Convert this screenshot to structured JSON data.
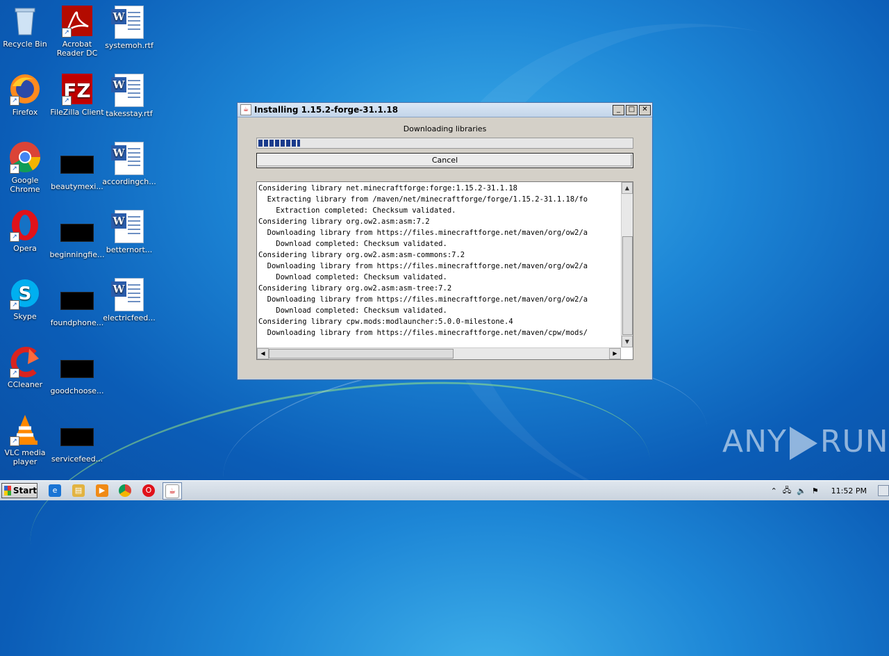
{
  "desktop": {
    "icons": [
      {
        "label": "Recycle Bin",
        "icon": "recycle-bin-icon"
      },
      {
        "label": "Acrobat Reader DC",
        "icon": "acrobat-icon"
      },
      {
        "label": "systemoh.rtf",
        "icon": "word-doc-icon"
      },
      {
        "label": "Firefox",
        "icon": "firefox-icon"
      },
      {
        "label": "FileZilla Client",
        "icon": "filezilla-icon"
      },
      {
        "label": "takesstay.rtf",
        "icon": "word-doc-icon"
      },
      {
        "label": "Google Chrome",
        "icon": "chrome-icon"
      },
      {
        "label": "beautymexi...",
        "icon": "black-thumb-icon"
      },
      {
        "label": "accordingch...",
        "icon": "word-doc-icon"
      },
      {
        "label": "Opera",
        "icon": "opera-icon"
      },
      {
        "label": "beginningfie...",
        "icon": "black-thumb-icon"
      },
      {
        "label": "betternort...",
        "icon": "word-doc-icon"
      },
      {
        "label": "Skype",
        "icon": "skype-icon"
      },
      {
        "label": "foundphone...",
        "icon": "black-thumb-icon"
      },
      {
        "label": "electricfeed...",
        "icon": "word-doc-icon"
      },
      {
        "label": "CCleaner",
        "icon": "ccleaner-icon"
      },
      {
        "label": "goodchoose...",
        "icon": "black-thumb-icon"
      },
      {
        "label": "VLC media player",
        "icon": "vlc-icon"
      },
      {
        "label": "servicefeed...",
        "icon": "black-thumb-icon"
      }
    ]
  },
  "dialog": {
    "title": "Installing 1.15.2-forge-31.1.18",
    "status": "Downloading libraries",
    "cancel_label": "Cancel",
    "progress": 0.11,
    "log_lines": [
      "Considering library net.minecraftforge:forge:1.15.2-31.1.18",
      "  Extracting library from /maven/net/minecraftforge/forge/1.15.2-31.1.18/fo",
      "    Extraction completed: Checksum validated.",
      "Considering library org.ow2.asm:asm:7.2",
      "  Downloading library from https://files.minecraftforge.net/maven/org/ow2/a",
      "    Download completed: Checksum validated.",
      "Considering library org.ow2.asm:asm-commons:7.2",
      "  Downloading library from https://files.minecraftforge.net/maven/org/ow2/a",
      "    Download completed: Checksum validated.",
      "Considering library org.ow2.asm:asm-tree:7.2",
      "  Downloading library from https://files.minecraftforge.net/maven/org/ow2/a",
      "    Download completed: Checksum validated.",
      "Considering library cpw.mods:modlauncher:5.0.0-milestone.4",
      "  Downloading library from https://files.minecraftforge.net/maven/cpw/mods/"
    ]
  },
  "taskbar": {
    "start_label": "Start",
    "pinned": [
      "ie-icon",
      "explorer-icon",
      "media-player-icon",
      "chrome-icon",
      "opera-icon",
      "java-installer-icon"
    ],
    "clock": "11:52 PM"
  },
  "watermark": {
    "left": "ANY",
    "right": "RUN"
  }
}
